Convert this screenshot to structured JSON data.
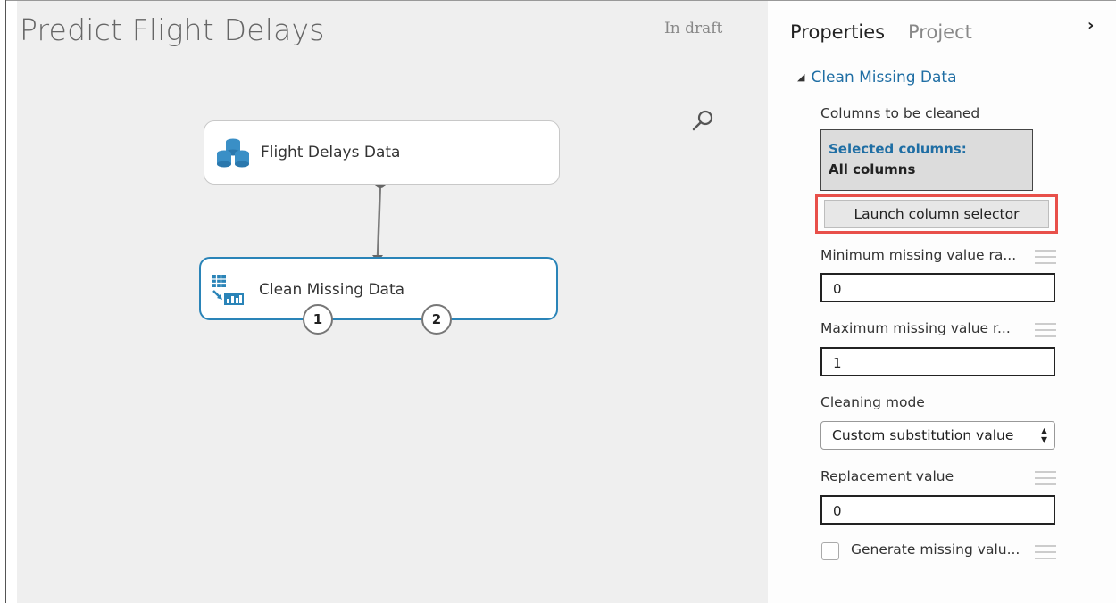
{
  "experiment": {
    "title": "Predict Flight Delays",
    "status": "In draft"
  },
  "canvas": {
    "modules": [
      {
        "label": "Flight Delays Data",
        "icon": "database-icon"
      },
      {
        "label": "Clean Missing Data",
        "icon": "clean-data-icon"
      }
    ],
    "output_ports": [
      "1",
      "2"
    ]
  },
  "panel": {
    "tabs": {
      "properties": "Properties",
      "project": "Project"
    },
    "section_title": "Clean Missing Data",
    "columns_label": "Columns to be cleaned",
    "selected_columns_title": "Selected columns:",
    "selected_columns_value": "All columns",
    "launch_button": "Launch column selector",
    "min_label": "Minimum missing value ra...",
    "min_value": "0",
    "max_label": "Maximum missing value r...",
    "max_value": "1",
    "mode_label": "Cleaning mode",
    "mode_value": "Custom substitution value",
    "replacement_label": "Replacement value",
    "replacement_value": "0",
    "generate_label": "Generate missing valu...",
    "generate_checked": false
  },
  "colors": {
    "accent": "#1f6ea4",
    "module_selected_border": "#2a84b8",
    "highlight": "#e8504a",
    "canvas_bg": "#efefef"
  }
}
